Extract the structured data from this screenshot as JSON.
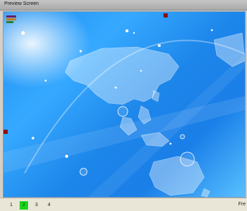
{
  "window": {
    "title": "Preview Screen"
  },
  "pages": {
    "tabs": [
      {
        "label": "1",
        "active": false
      },
      {
        "label": "2",
        "active": true
      },
      {
        "label": "3",
        "active": false
      },
      {
        "label": "4",
        "active": false
      }
    ]
  },
  "status": {
    "text": "Fre"
  },
  "colors": {
    "active_tab": "#17d41a",
    "preview_blue": "#1a86ea",
    "marker_red": "#8a1010"
  },
  "icons": {
    "preview_image": "world-map-wallpaper"
  }
}
